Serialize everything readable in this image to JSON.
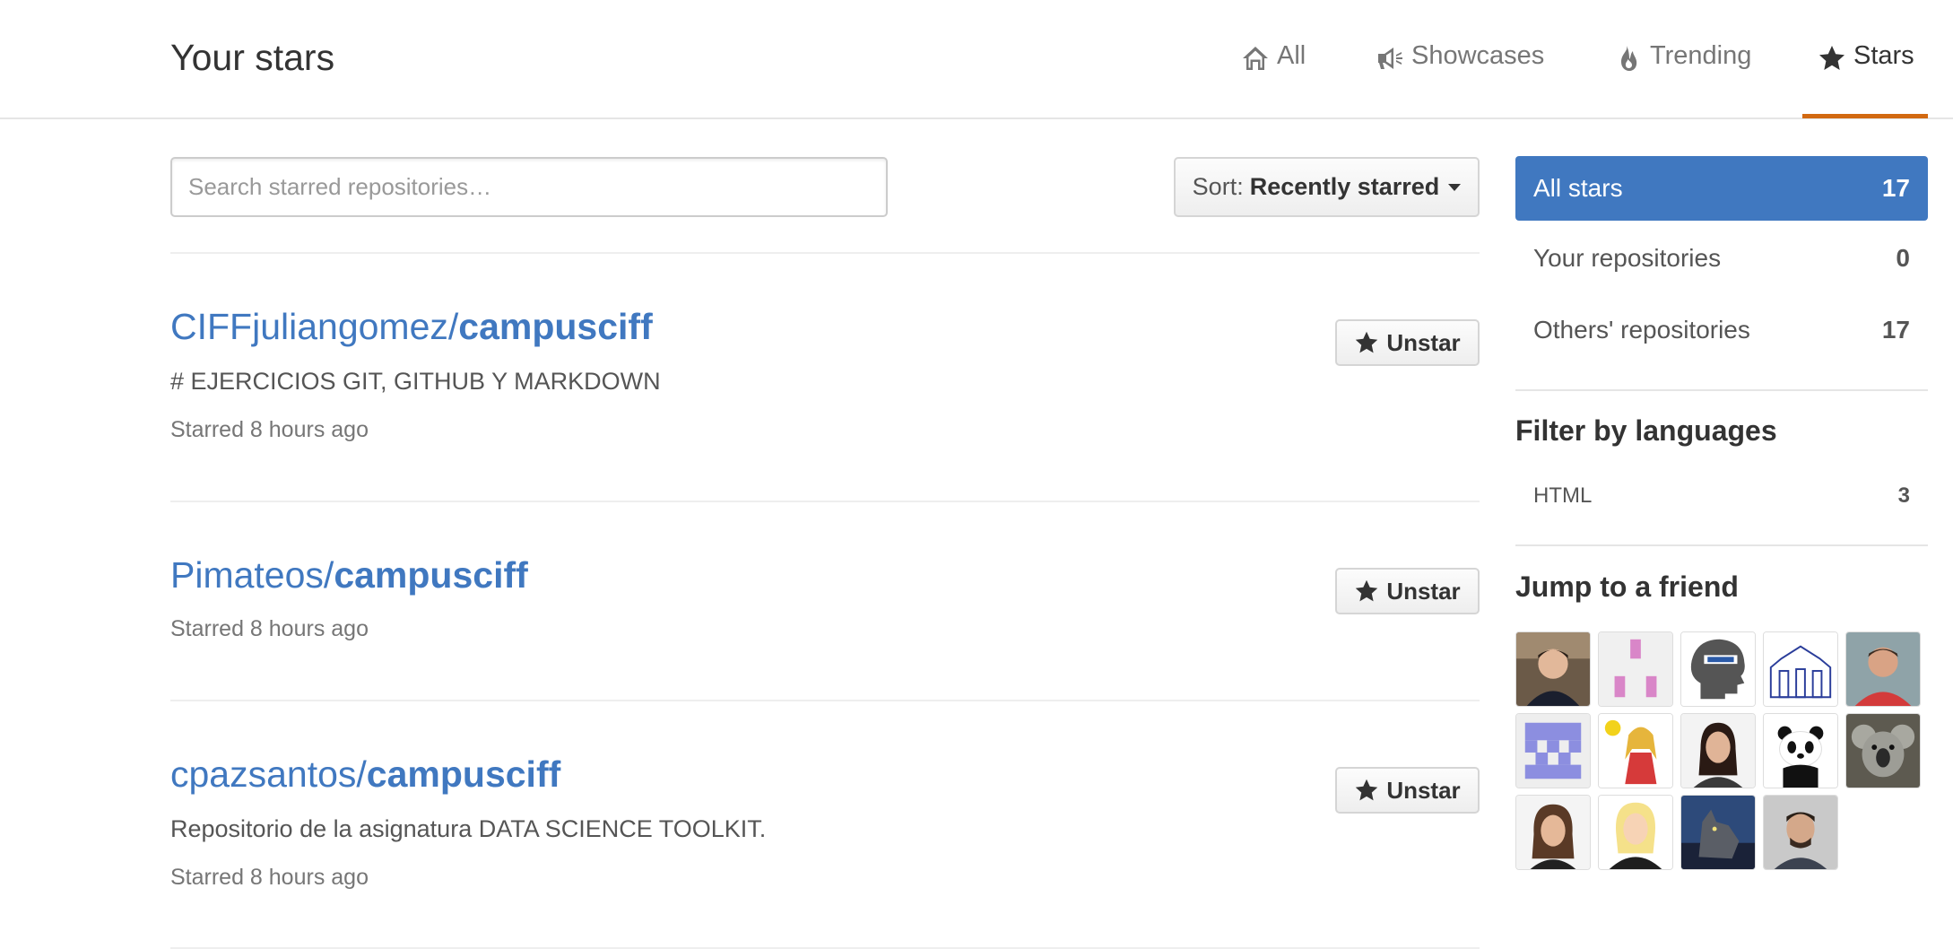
{
  "header": {
    "title": "Your stars",
    "nav": [
      {
        "label": "All",
        "icon": "home-icon"
      },
      {
        "label": "Showcases",
        "icon": "megaphone-icon"
      },
      {
        "label": "Trending",
        "icon": "flame-icon"
      },
      {
        "label": "Stars",
        "icon": "star-icon",
        "selected": true
      }
    ],
    "accent_color": "#d26911"
  },
  "main": {
    "search": {
      "placeholder": "Search starred repositories…",
      "value": ""
    },
    "sort": {
      "label": "Sort:",
      "value": "Recently starred"
    },
    "repos": [
      {
        "owner": "CIFFjuliangomez/",
        "name": "campusciff",
        "description": "# EJERCICIOS GIT, GITHUB Y MARKDOWN",
        "starred": "Starred 8 hours ago",
        "button": "Unstar"
      },
      {
        "owner": "Pimateos/",
        "name": "campusciff",
        "description": "",
        "starred": "Starred 8 hours ago",
        "button": "Unstar"
      },
      {
        "owner": "cpazsantos/",
        "name": "campusciff",
        "description": "Repositorio de la asignatura DATA SCIENCE TOOLKIT.",
        "starred": "Starred 8 hours ago",
        "button": "Unstar"
      }
    ],
    "link_color": "#4078c0"
  },
  "sidebar": {
    "filters": [
      {
        "label": "All stars",
        "count": "17",
        "selected": true
      },
      {
        "label": "Your repositories",
        "count": "0"
      },
      {
        "label": "Others' repositories",
        "count": "17"
      }
    ],
    "languages_heading": "Filter by languages",
    "languages": [
      {
        "label": "HTML",
        "count": "3"
      }
    ],
    "friends_heading": "Jump to a friend",
    "friend_count": 14,
    "selected_color": "#4078c0"
  }
}
